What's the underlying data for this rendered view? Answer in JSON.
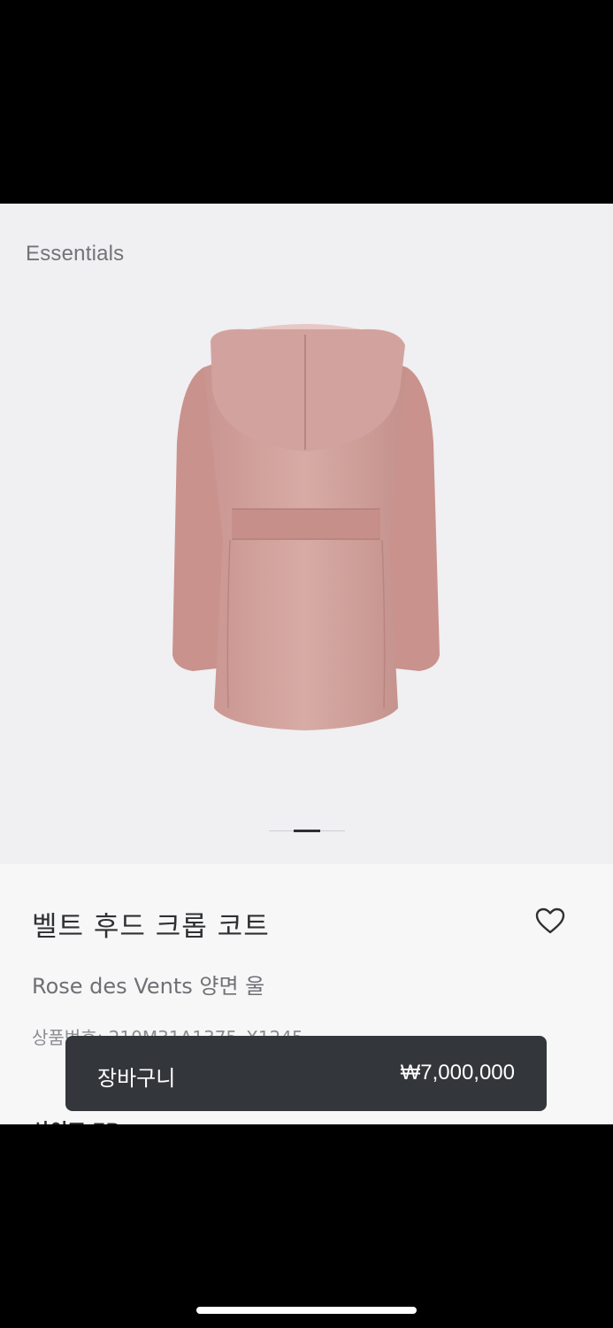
{
  "gallery": {
    "collection_label": "Essentials",
    "image_alt": "pink hooded belted coat, back view",
    "pagination": {
      "count": 3,
      "active_index": 1
    }
  },
  "product": {
    "title": "벨트 후드 크롭 코트",
    "subtitle": "Rose des Vents 양면 울",
    "sku": "상품번호: 210M31A1375_X1245",
    "size_label": "사이즈 FR"
  },
  "cart_bar": {
    "label": "장바구니",
    "price": "₩7,000,000"
  },
  "colors": {
    "gallery_bg": "#f0eff2",
    "coat": "#d4a5a0",
    "cart_bar": "#33363b",
    "text_dark": "#2f3034"
  }
}
